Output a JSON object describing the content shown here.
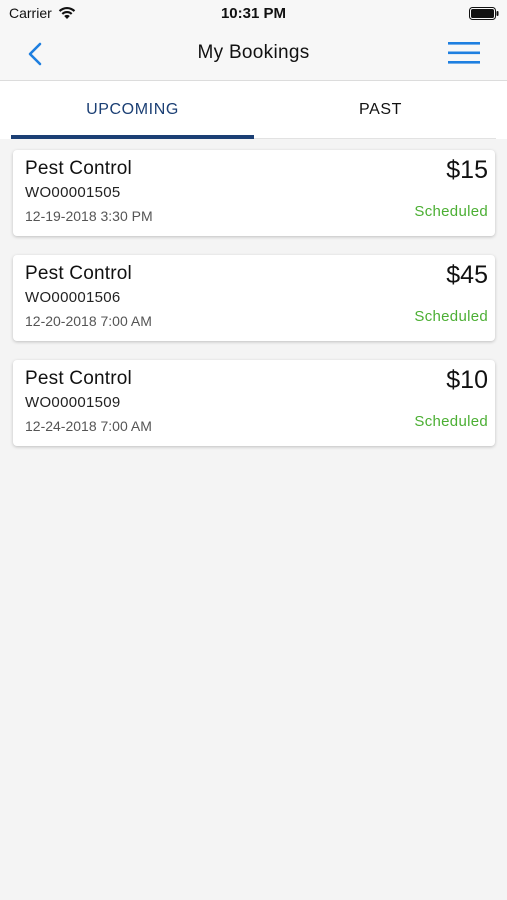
{
  "status_bar": {
    "carrier": "Carrier",
    "time": "10:31 PM",
    "icons": [
      "wifi-icon",
      "battery-icon"
    ]
  },
  "nav": {
    "title": "My Bookings",
    "back_icon": "chevron-left-icon",
    "menu_icon": "hamburger-menu-icon"
  },
  "tabs": [
    {
      "label": "UPCOMING",
      "active": true
    },
    {
      "label": "PAST",
      "active": false
    }
  ],
  "bookings": [
    {
      "service": "Pest Control",
      "number": "WO00001505",
      "datetime": "12-19-2018 3:30 PM",
      "price": "$15",
      "status": "Scheduled"
    },
    {
      "service": "Pest Control",
      "number": "WO00001506",
      "datetime": "12-20-2018 7:00 AM",
      "price": "$45",
      "status": "Scheduled"
    },
    {
      "service": "Pest Control",
      "number": "WO00001509",
      "datetime": "12-24-2018 7:00 AM",
      "price": "$10",
      "status": "Scheduled"
    }
  ],
  "colors": {
    "accent": "#1b3f74",
    "nav_icon": "#1e7fe0",
    "status_scheduled": "#4caf34",
    "background": "#f4f4f4"
  }
}
